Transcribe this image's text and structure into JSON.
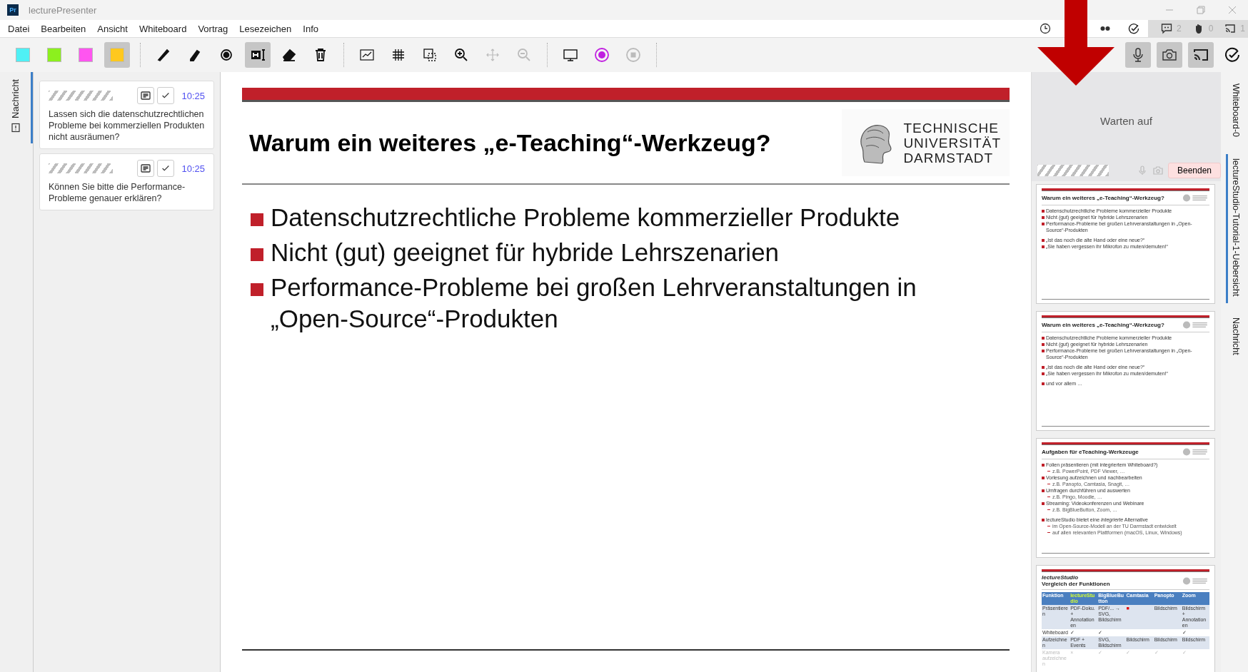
{
  "window": {
    "app_icon": "Pr",
    "title": "lecturePresenter"
  },
  "menu": [
    "Datei",
    "Bearbeiten",
    "Ansicht",
    "Whiteboard",
    "Vortrag",
    "Lesezeichen",
    "Info"
  ],
  "status": {
    "messages": "2",
    "hands": "0",
    "viewers": "1"
  },
  "palette": [
    {
      "color": "#4ff0f5",
      "selected": false
    },
    {
      "color": "#8cf01e",
      "selected": false
    },
    {
      "color": "#ff55f0",
      "selected": false
    },
    {
      "color": "#ffc81e",
      "selected": true
    }
  ],
  "tool_groups": [
    [
      {
        "kind": "pen",
        "selected": false,
        "disabled": false
      },
      {
        "kind": "highlighter",
        "selected": false,
        "disabled": false
      },
      {
        "kind": "pointer",
        "selected": false,
        "disabled": false
      },
      {
        "kind": "text",
        "selected": true,
        "disabled": false
      },
      {
        "kind": "eraser",
        "selected": false,
        "disabled": false
      },
      {
        "kind": "delete",
        "selected": false,
        "disabled": false
      }
    ],
    [
      {
        "kind": "whiteboard",
        "selected": false,
        "disabled": false
      },
      {
        "kind": "grid",
        "selected": false,
        "disabled": false
      },
      {
        "kind": "select",
        "selected": false,
        "disabled": false
      },
      {
        "kind": "zoom-in",
        "selected": false,
        "disabled": false
      },
      {
        "kind": "pan",
        "selected": false,
        "disabled": true
      },
      {
        "kind": "zoom-out",
        "selected": false,
        "disabled": true
      }
    ],
    [
      {
        "kind": "display",
        "selected": false,
        "disabled": false
      },
      {
        "kind": "record",
        "selected": false,
        "disabled": false
      },
      {
        "kind": "stop",
        "selected": false,
        "disabled": true
      }
    ]
  ],
  "left_tab": {
    "label": "Nachricht",
    "selected": true
  },
  "messages": [
    {
      "time": "10:25",
      "text": "Lassen sich die datenschutzrechtlichen Probleme bei kommerziellen Produkten nicht ausräumen?"
    },
    {
      "time": "10:25",
      "text": "Können Sie bitte die Performance-Probleme genauer erklären?"
    }
  ],
  "slide": {
    "title": "Warum ein weiteres „e-Teaching“-Werkzeug?",
    "logo": [
      "TECHNISCHE",
      "UNIVERSITÄT",
      "DARMSTADT"
    ],
    "bullets": [
      "Datenschutzrechtliche Probleme kommerzieller Produkte",
      "Nicht (gut) geeignet für hybride Lehrszenarien",
      "Performance-Probleme bei großen Lehrveranstaltungen in „Open-Source“-Produkten"
    ]
  },
  "presenter": {
    "status": "Warten auf",
    "end_button": "Beenden"
  },
  "thumbnails": [
    {
      "kind": "bullets",
      "title": "Warum ein weiteres „e-Teaching“-Werkzeug?",
      "groups": [
        [
          {
            "text": "Datenschutzrechtliche Probleme kommerzieller Produkte"
          },
          {
            "text": "Nicht (gut) geeignet für hybride Lehrszenarien"
          },
          {
            "text": "Performance-Probleme bei großen Lehrveranstaltungen in „Open-Source“-Produkten"
          }
        ],
        [
          {
            "text": "„Ist das noch die alte Hand oder eine neue?“"
          },
          {
            "text": "„Sie haben vergessen ihr Mikrofon zu muten/demuten!“"
          }
        ]
      ]
    },
    {
      "kind": "bullets",
      "title": "Warum ein weiteres „e-Teaching“-Werkzeug?",
      "groups": [
        [
          {
            "text": "Datenschutzrechtliche Probleme kommerzieller Produkte"
          },
          {
            "text": "Nicht (gut) geeignet für hybride Lehrszenarien"
          },
          {
            "text": "Performance-Probleme bei großen Lehrveranstaltungen in „Open-Source“-Produkten"
          }
        ],
        [
          {
            "text": "„Ist das noch die alte Hand oder eine neue?“"
          },
          {
            "text": "„Sie haben vergessen ihr Mikrofon zu muten/demuten!“"
          }
        ],
        [
          {
            "text": "und vor allem …"
          }
        ]
      ]
    },
    {
      "kind": "bullets",
      "title": "Aufgaben für eTeaching-Werkzeuge",
      "groups": [
        [
          {
            "text": "Folien präsentieren (mit integriertem Whiteboard?)",
            "sub": [
              "z.B. PowerPoint, PDF Viewer, …"
            ]
          },
          {
            "text": "Vorlesung aufzeichnen und nachbearbeiten",
            "sub": [
              "z.B. Panopto, Camtasia, Snagit, …"
            ]
          },
          {
            "text": "Umfragen durchführen und auswerten",
            "sub": [
              "z.B. Pingo, Moodle, …"
            ]
          },
          {
            "text": "Streaming: Videokonferenzen und Webinare",
            "sub": [
              "z.B. BigBlueButton, Zoom, …"
            ]
          }
        ],
        [
          {
            "text": "lectureStudio bietet eine *integrierte* Alternative",
            "sub": [
              "im Open-Source-Modell an der TU Darmstadt entwickelt",
              "auf allen relevanten Plattformen (macOS, Linux, Windows)"
            ]
          }
        ]
      ]
    },
    {
      "kind": "table",
      "title_top": "lectureStudio",
      "title": "Vergleich der Funktionen",
      "columns": [
        {
          "label": "Funktion",
          "highlight": false
        },
        {
          "label": "lectureStudio",
          "highlight": true
        },
        {
          "label": "BigBlueButton",
          "highlight": false
        },
        {
          "label": "Camtasia",
          "highlight": false
        },
        {
          "label": "Panopto",
          "highlight": false
        },
        {
          "label": "Zoom",
          "highlight": false
        }
      ],
      "rows": [
        {
          "dim": false,
          "cells": [
            "Präsentieren",
            "PDF-Doku. + Annotationen",
            "PDF/... → SVG, Bildschirm",
            "■",
            "Bildschirm",
            "Bildschirm + Annotationen"
          ]
        },
        {
          "dim": false,
          "cells": [
            "Whiteboard",
            "✓",
            "✓",
            "",
            "",
            "✓"
          ]
        },
        {
          "dim": false,
          "cells": [
            "Aufzeichnen",
            "PDF + Events",
            "SVG, Bildschirm",
            "Bildschirm",
            "Bildschirm",
            "Bildschirm"
          ]
        },
        {
          "dim": true,
          "cells": [
            "Kamera aufzeichnen",
            "×",
            "✓",
            "✓",
            "✓",
            "✓"
          ]
        }
      ]
    }
  ],
  "right_tabs": [
    {
      "label": "Whiteboard-0",
      "selected": false
    },
    {
      "label": "lectureStudio-Tutorial-1-Uebersicht",
      "selected": true
    },
    {
      "label": "Nachricht",
      "selected": false
    }
  ]
}
